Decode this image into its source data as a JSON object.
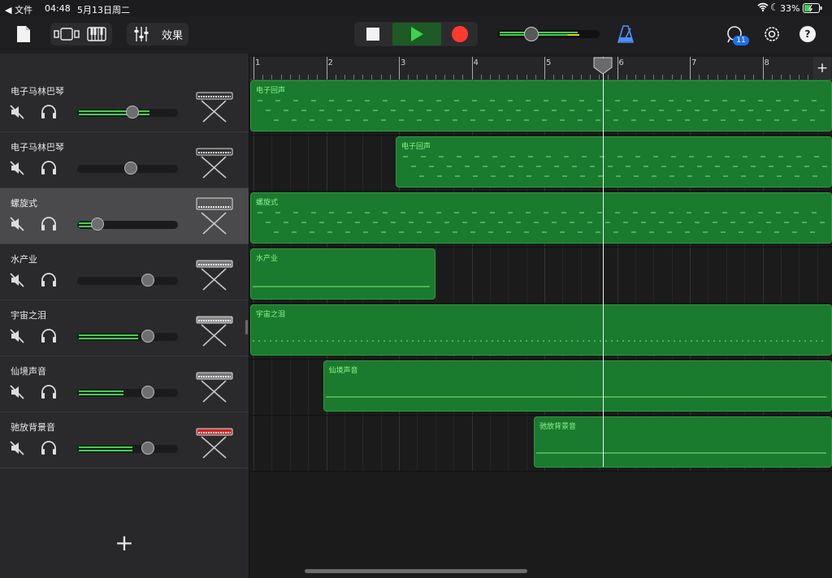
{
  "status": {
    "back": "◀ 文件",
    "time": "04:48",
    "date": "5月13日周二",
    "battery": "33%"
  },
  "toolbar": {
    "fx_label": "效果",
    "badge": "11",
    "help": "?"
  },
  "sidebar": {
    "tracks": [
      {
        "name": "电子马林巴琴",
        "volume": 0.55,
        "level": 0.7
      },
      {
        "name": "电子马林巴琴",
        "volume": 0.53,
        "level": 0
      },
      {
        "name": "螺旋式",
        "volume": 0.2,
        "level": 0.19
      },
      {
        "name": "水产业",
        "volume": 0.7,
        "level": 0
      },
      {
        "name": "宇宙之泪",
        "volume": 0.7,
        "level": 0.59
      },
      {
        "name": "仙境声音",
        "volume": 0.7,
        "level": 0.44
      },
      {
        "name": "驰放背景音",
        "volume": 0.7,
        "level": 0.53
      }
    ],
    "add": "+"
  },
  "ruler": {
    "bars": [
      "1",
      "2",
      "3",
      "4",
      "5",
      "6",
      "7",
      "8"
    ],
    "add": "+"
  },
  "regions": [
    {
      "track": 0,
      "label": "电子回声",
      "start": 1,
      "end": 9
    },
    {
      "track": 1,
      "label": "电子回声",
      "start": 3,
      "end": 9
    },
    {
      "track": 2,
      "label": "螺旋式",
      "start": 1,
      "end": 9
    },
    {
      "track": 3,
      "label": "水产业",
      "start": 1,
      "end": 3.5
    },
    {
      "track": 4,
      "label": "宇宙之泪",
      "start": 1,
      "end": 9
    },
    {
      "track": 5,
      "label": "仙境声音",
      "start": 2,
      "end": 9
    },
    {
      "track": 6,
      "label": "驰放背景音",
      "start": 4.9,
      "end": 9
    }
  ],
  "colors": {
    "accent": "#3fd04f",
    "region": "#1a7a2e",
    "record": "#ff3b30"
  }
}
